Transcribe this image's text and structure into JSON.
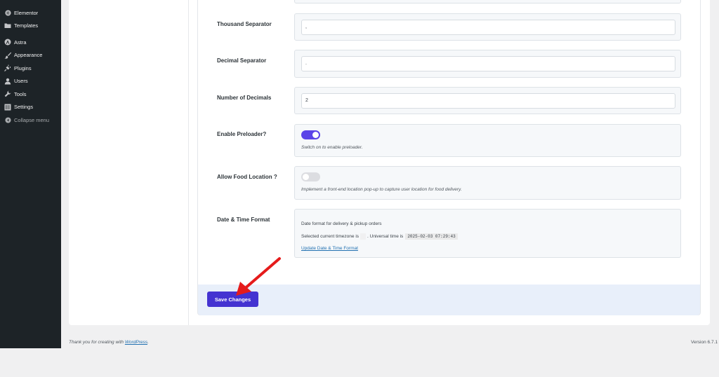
{
  "sidebar": {
    "items": [
      {
        "label": "Elementor",
        "icon": "elementor-icon"
      },
      {
        "label": "Templates",
        "icon": "folder-icon"
      },
      {
        "label": "Astra",
        "icon": "astra-icon"
      },
      {
        "label": "Appearance",
        "icon": "paintbrush-icon"
      },
      {
        "label": "Plugins",
        "icon": "plug-icon"
      },
      {
        "label": "Users",
        "icon": "user-icon"
      },
      {
        "label": "Tools",
        "icon": "wrench-icon"
      },
      {
        "label": "Settings",
        "icon": "settings-icon"
      }
    ],
    "collapse_label": "Collapse menu"
  },
  "settings": {
    "thousand_separator": {
      "label": "Thousand Separator",
      "value": ","
    },
    "decimal_separator": {
      "label": "Decimal Separator",
      "value": "."
    },
    "number_of_decimals": {
      "label": "Number of Decimals",
      "value": "2"
    },
    "enable_preloader": {
      "label": "Enable Preloader?",
      "hint": "Switch on to enable preloader.",
      "enabled": true
    },
    "allow_food_location": {
      "label": "Allow Food Location ?",
      "hint": "Implement a front-end location pop-up to capture user location for food delivery.",
      "enabled": false
    },
    "date_time_format": {
      "label": "Date & Time Format",
      "description": "Date format for delivery & pickup orders",
      "timezone_prefix": "Selected current timezone is",
      "universal_prefix": ". Universal time is",
      "universal_time": "2025-02-03 07:29:43",
      "update_link": "Update Date & Time Format"
    }
  },
  "save_label": "Save Changes",
  "footer": {
    "thanks_prefix": "Thank you for creating with",
    "wp_link": "WordPress",
    "thanks_suffix": ".",
    "version": "Version 6.7.1"
  },
  "colors": {
    "accent": "#4433d1",
    "toggle_on": "#5b44e8",
    "arrow": "#e51b1b",
    "sidebar": "#1d2327"
  }
}
